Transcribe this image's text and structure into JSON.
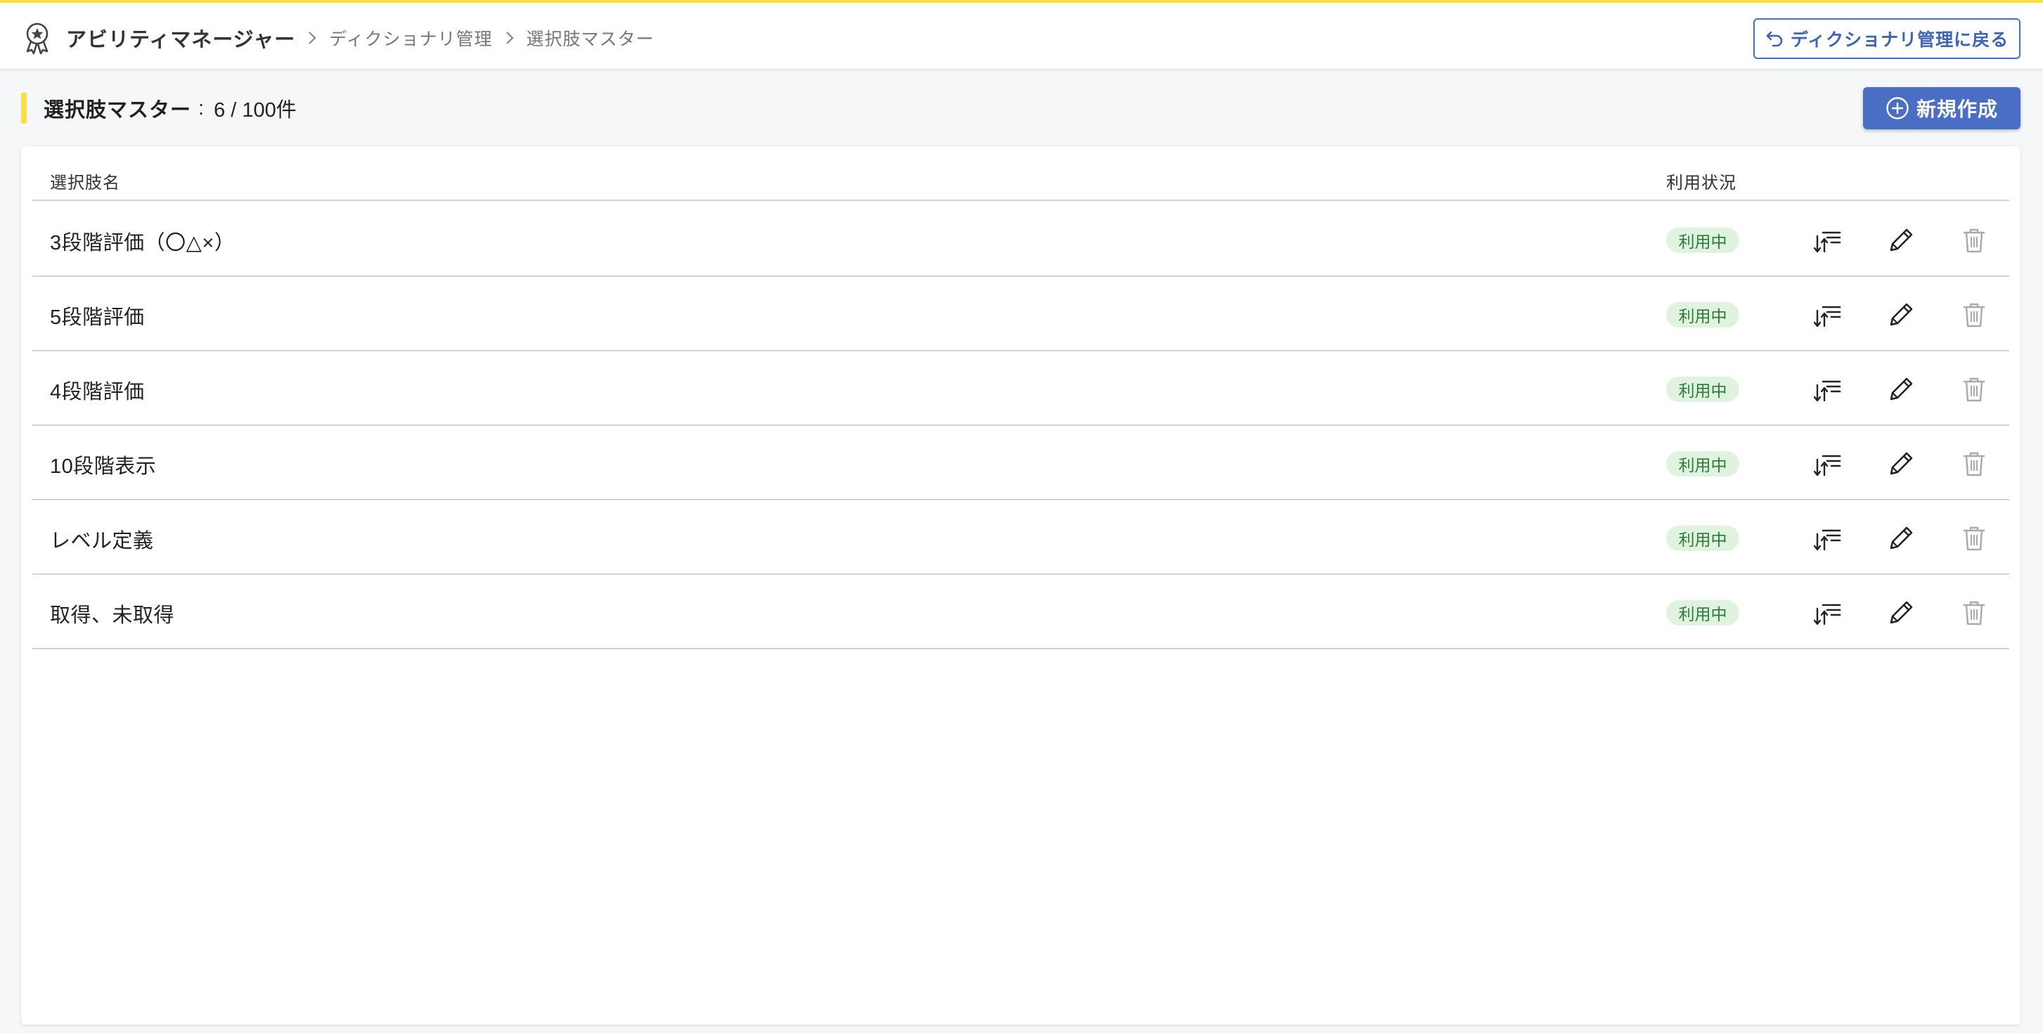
{
  "header": {
    "app_name": "アビリティマネージャー",
    "breadcrumbs": [
      "ディクショナリ管理",
      "選択肢マスター"
    ],
    "back_button_label": "ディクショナリ管理に戻る",
    "app_icon": "award-badge-icon",
    "accent_color": "#f7df45"
  },
  "page": {
    "title": "選択肢マスター",
    "separator": ":",
    "count": "6 / 100件",
    "new_button_label": "新規作成"
  },
  "table": {
    "columns": [
      "選択肢名",
      "利用状況"
    ],
    "rows": [
      {
        "name": "3段階評価（〇△×）",
        "status": "利用中"
      },
      {
        "name": "5段階評価",
        "status": "利用中"
      },
      {
        "name": "4段階評価",
        "status": "利用中"
      },
      {
        "name": "10段階表示",
        "status": "利用中"
      },
      {
        "name": "レベル定義",
        "status": "利用中"
      },
      {
        "name": "取得、未取得",
        "status": "利用中"
      }
    ],
    "row_actions": [
      "sort-icon",
      "pencil-icon",
      "trash-icon"
    ]
  },
  "colors": {
    "primary": "#4a6ec3",
    "badge_bg": "#dff3df",
    "badge_text": "#2b7a3a"
  }
}
